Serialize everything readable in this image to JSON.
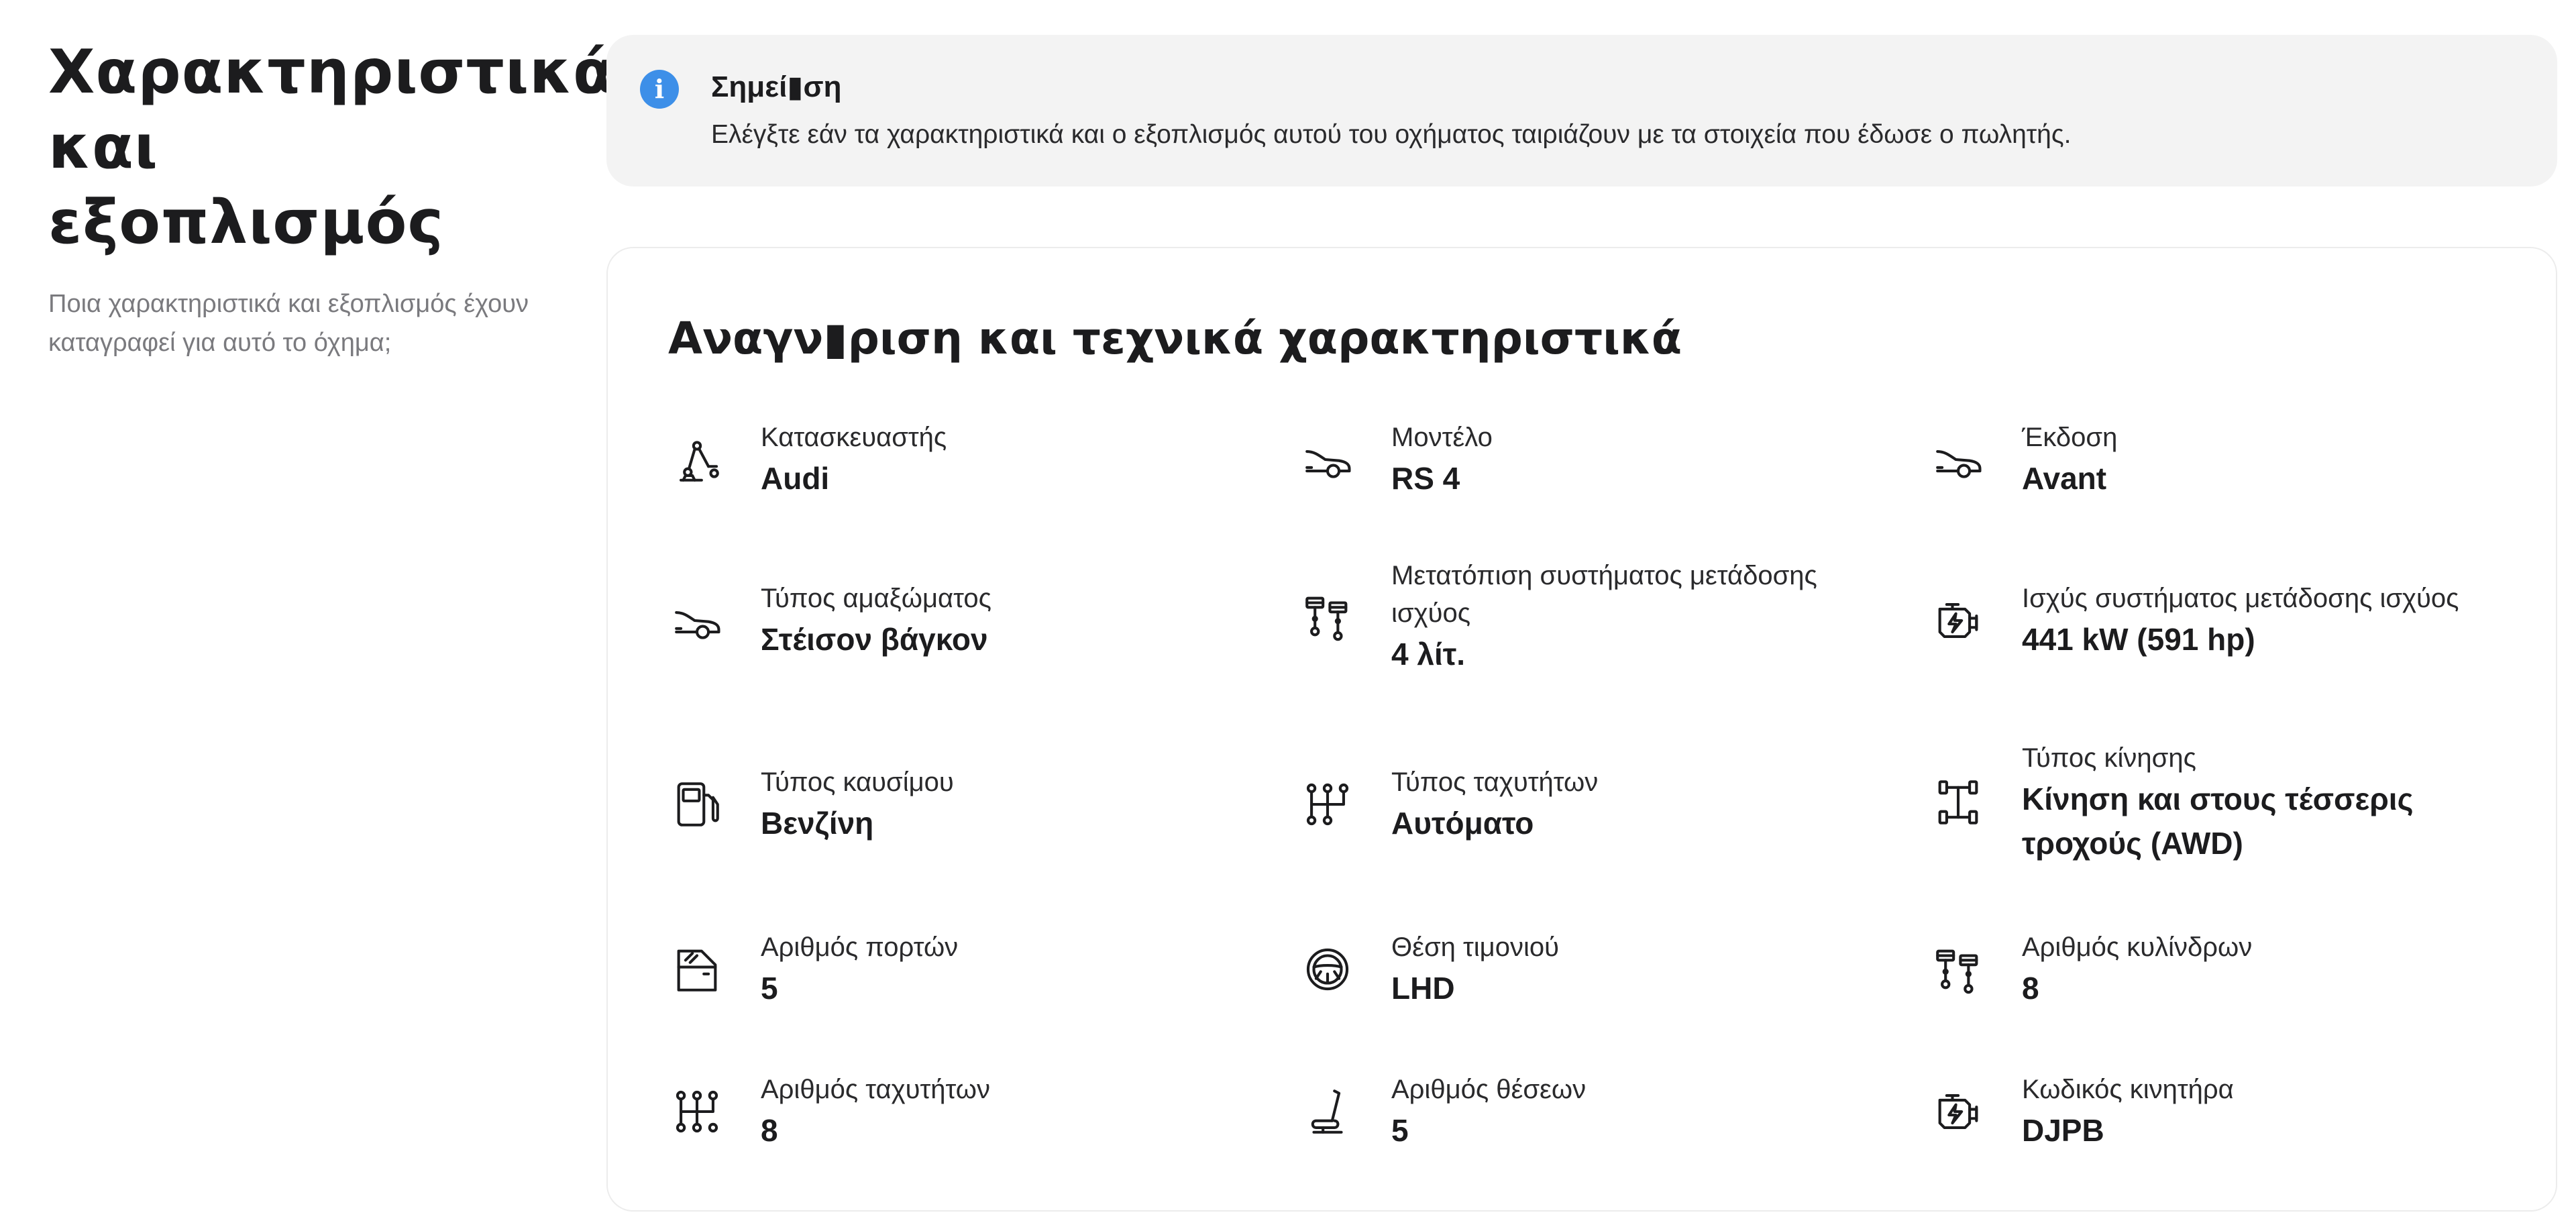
{
  "sidebar": {
    "title_line1": "Χαρακτηριστικά",
    "title_line2": "και εξοπλισμός",
    "subtitle": "Ποια χαρακτηριστικά και εξοπλισμός έχουν καταγραφεί για αυτό το όχημα;"
  },
  "notice": {
    "icon": "info-icon",
    "title": "Σημεί▮ση",
    "text": "Ελέγξτε εάν τα χαρακτηριστικά και ο εξοπλισμός αυτού του οχήματος ταιριάζουν με τα στοιχεία που έδωσε ο πωλητής.",
    "accent_color": "#3d8fe8"
  },
  "card": {
    "title": "Αναγν▮ριση και τεχνικά χαρακτηριστικά",
    "specs": [
      {
        "icon": "robot-arm-icon",
        "label": "Κατασκευαστής",
        "value": "Audi"
      },
      {
        "icon": "car-icon",
        "label": "Μοντέλο",
        "value": "RS 4"
      },
      {
        "icon": "car-icon",
        "label": "Έκδοση",
        "value": "Avant"
      },
      {
        "icon": "car-icon",
        "label": "Τύπος αμαξώματος",
        "value": "Στέισον βάγκον"
      },
      {
        "icon": "pistons-icon",
        "label": "Μετατόπιση συστήματος μετάδοσης ισχύος",
        "value": "4 λίτ."
      },
      {
        "icon": "engine-icon",
        "label": "Ισχύς συστήματος μετάδοσης ισχύος",
        "value": "441 kW (591 hp)"
      },
      {
        "icon": "fuel-pump-icon",
        "label": "Τύπος καυσίμου",
        "value": "Βενζίνη"
      },
      {
        "icon": "gearbox-icon",
        "label": "Τύπος ταχυτήτων",
        "value": "Αυτόματο"
      },
      {
        "icon": "drivetrain-icon",
        "label": "Τύπος κίνησης",
        "value": "Κίνηση και στους τέσσερις τροχούς (AWD)"
      },
      {
        "icon": "car-door-icon",
        "label": "Αριθμός πορτών",
        "value": "5"
      },
      {
        "icon": "steering-wheel-icon",
        "label": "Θέση τιμονιού",
        "value": "LHD"
      },
      {
        "icon": "pistons-icon",
        "label": "Αριθμός κυλίνδρων",
        "value": "8"
      },
      {
        "icon": "gearbox-icon",
        "label": "Αριθμός ταχυτήτων",
        "value": "8"
      },
      {
        "icon": "seat-icon",
        "label": "Αριθμός θέσεων",
        "value": "5"
      },
      {
        "icon": "engine-icon",
        "label": "Κωδικός κινητήρα",
        "value": "DJPB"
      }
    ]
  }
}
